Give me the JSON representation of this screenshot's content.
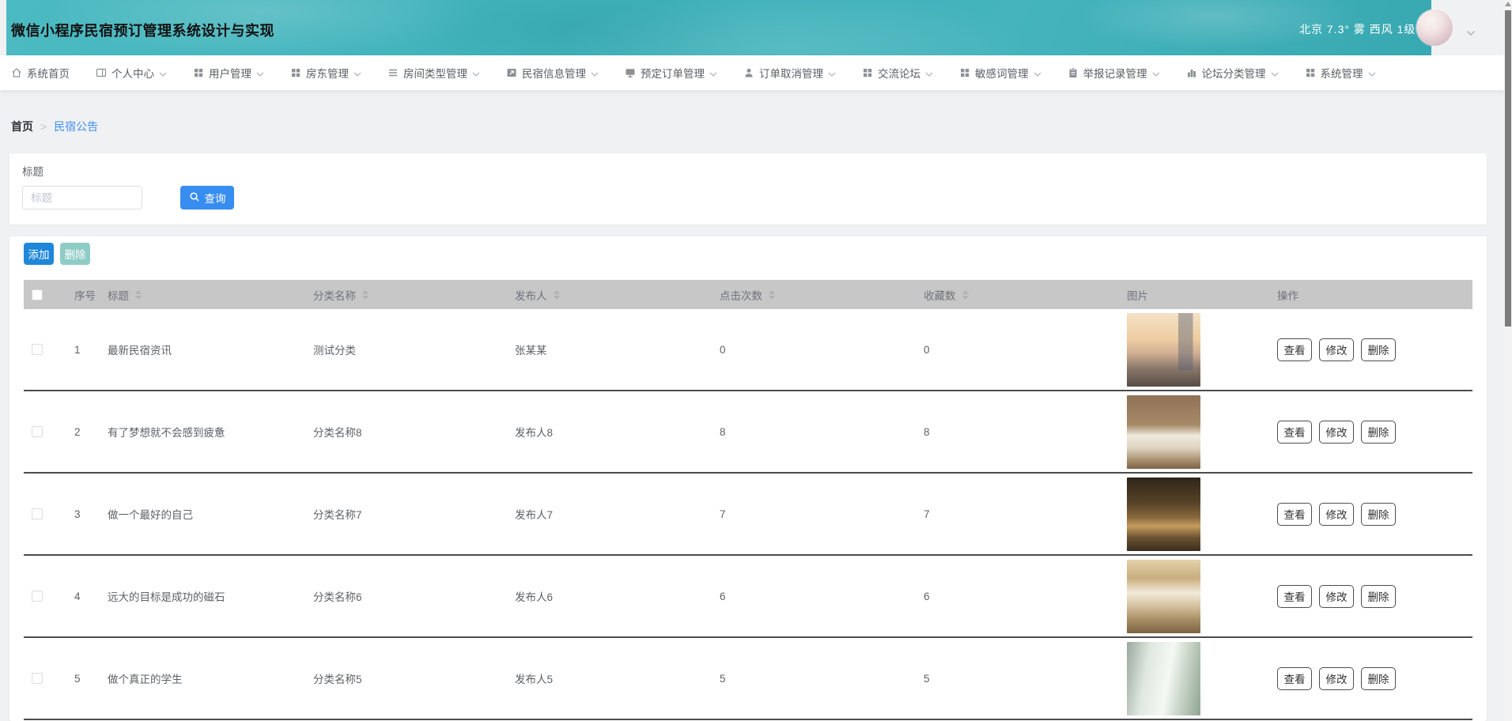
{
  "header": {
    "title": "微信小程序民宿预订管理系统设计与实现",
    "weather": "北京 7.3° 雾 西风 1级",
    "avatar": "user-avatar"
  },
  "nav": {
    "items": [
      {
        "label": "系统首页",
        "icon": "home-icon",
        "chevron": false
      },
      {
        "label": "个人中心",
        "icon": "panel-icon",
        "chevron": true
      },
      {
        "label": "用户管理",
        "icon": "grid-icon",
        "chevron": true
      },
      {
        "label": "房东管理",
        "icon": "grid-icon",
        "chevron": true
      },
      {
        "label": "房间类型管理",
        "icon": "list-icon",
        "chevron": true
      },
      {
        "label": "民宿信息管理",
        "icon": "image-icon",
        "chevron": true
      },
      {
        "label": "预定订单管理",
        "icon": "monitor-icon",
        "chevron": true
      },
      {
        "label": "订单取消管理",
        "icon": "user-icon",
        "chevron": true
      },
      {
        "label": "交流论坛",
        "icon": "grid-icon",
        "chevron": true
      },
      {
        "label": "敏感词管理",
        "icon": "grid-icon",
        "chevron": true
      },
      {
        "label": "举报记录管理",
        "icon": "clipboard-icon",
        "chevron": true
      },
      {
        "label": "论坛分类管理",
        "icon": "chart-icon",
        "chevron": true
      },
      {
        "label": "系统管理",
        "icon": "grid-icon",
        "chevron": true
      }
    ]
  },
  "breadcrumb": {
    "home": "首页",
    "separator": ">",
    "current": "民宿公告"
  },
  "search": {
    "label": "标题",
    "placeholder": "标题",
    "value": "",
    "button": "查询"
  },
  "toolbar": {
    "add": "添加",
    "delete": "删除"
  },
  "table": {
    "columns": [
      "序号",
      "标题",
      "分类名称",
      "发布人",
      "点击次数",
      "收藏数",
      "图片",
      "操作"
    ],
    "actions": [
      "查看",
      "修改",
      "删除"
    ],
    "rows": [
      {
        "index": "1",
        "title": "最新民宿资讯",
        "category": "测试分类",
        "publisher": "张某某",
        "clicks": "0",
        "favorites": "0",
        "image": "city-skyline-sunset"
      },
      {
        "index": "2",
        "title": "有了梦想就不会感到疲惫",
        "category": "分类名称8",
        "publisher": "发布人8",
        "clicks": "8",
        "favorites": "8",
        "image": "hotel-bedroom-twin-beds"
      },
      {
        "index": "3",
        "title": "做一个最好的自己",
        "category": "分类名称7",
        "publisher": "发布人7",
        "clicks": "7",
        "favorites": "7",
        "image": "restaurant-interior-warm"
      },
      {
        "index": "4",
        "title": "远大的目标是成功的磁石",
        "category": "分类名称6",
        "publisher": "发布人6",
        "clicks": "6",
        "favorites": "6",
        "image": "wooden-loft-interior"
      },
      {
        "index": "5",
        "title": "做个真正的学生",
        "category": "分类名称5",
        "publisher": "发布人5",
        "clicks": "5",
        "favorites": "5",
        "image": "bright-bathroom-window"
      }
    ]
  },
  "colors": {
    "banner_teal": "#41b2ba",
    "query_blue": "#378df0",
    "add_blue": "#1e87da",
    "delete_disabled_teal": "#8fccc6",
    "table_header_gray": "#c7c7c7",
    "link_blue": "#3d8ff0",
    "row_border_dark": "#4c4c4c"
  }
}
